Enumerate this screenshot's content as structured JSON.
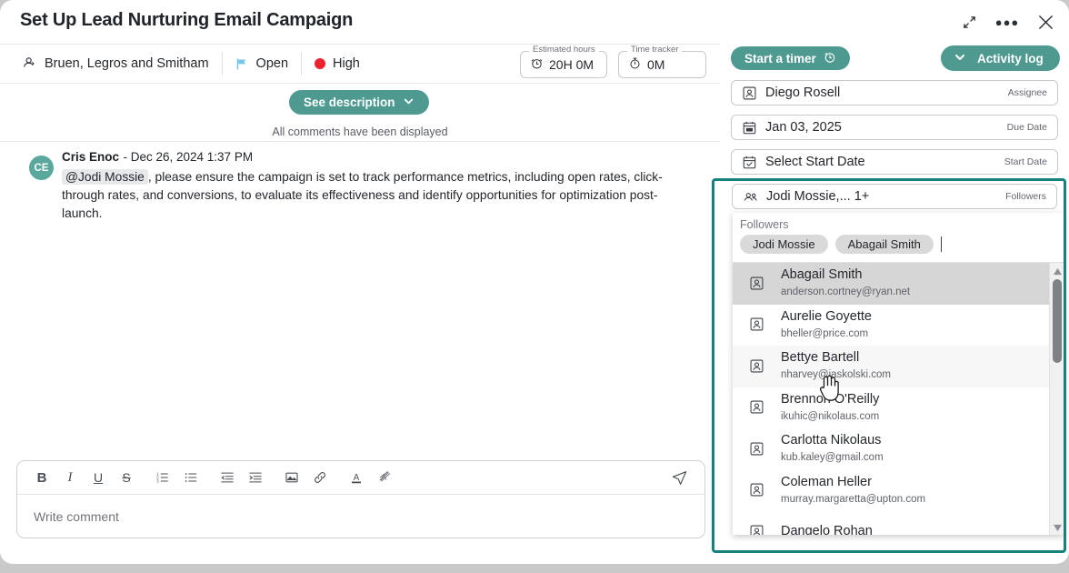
{
  "window": {
    "title": "Set Up Lead Nurturing Email Campaign",
    "expand_icon": "expand-icon",
    "more_icon": "ellipsis-icon",
    "close_icon": "close-icon"
  },
  "meta": {
    "company": "Bruen, Legros and Smitham",
    "company_icon": "company-icon",
    "status": "Open",
    "status_icon": "flag-icon",
    "priority": "High",
    "priority_icon": "priority-dot-icon",
    "estimated_hours": {
      "legend": "Estimated hours",
      "value": "20H 0M",
      "icon": "alarm-clock-icon"
    },
    "time_tracker": {
      "legend": "Time tracker",
      "value": "0M",
      "icon": "stopwatch-icon"
    }
  },
  "description": {
    "see_description_label": "See description",
    "chevron_icon": "chevron-down-icon"
  },
  "comments": {
    "status_line": "All comments have been displayed",
    "items": [
      {
        "initials": "CE",
        "author": "Cris Enoc",
        "date": "- Dec 26, 2024 1:37 PM",
        "mention": "@Jodi Mossie",
        "text": ", please ensure the campaign is set to track performance metrics, including open rates, click-through rates, and conversions, to evaluate its effectiveness and identify opportunities for optimization post-launch."
      }
    ]
  },
  "editor": {
    "placeholder": "Write comment",
    "tools": [
      {
        "name": "bold-icon",
        "glyph": "B"
      },
      {
        "name": "italic-icon",
        "glyph": "I"
      },
      {
        "name": "underline-icon",
        "glyph": "U"
      },
      {
        "name": "strikethrough-icon",
        "glyph": "S"
      },
      {
        "name": "ordered-list-icon",
        "glyph": ""
      },
      {
        "name": "bullet-list-icon",
        "glyph": ""
      },
      {
        "name": "outdent-icon",
        "glyph": ""
      },
      {
        "name": "indent-icon",
        "glyph": ""
      },
      {
        "name": "image-icon",
        "glyph": ""
      },
      {
        "name": "link-icon",
        "glyph": ""
      },
      {
        "name": "text-color-icon",
        "glyph": "A"
      },
      {
        "name": "clear-format-icon",
        "glyph": ""
      }
    ],
    "send_icon": "send-icon"
  },
  "sidebar": {
    "start_timer_label": "Start a timer",
    "start_timer_icon": "timer-icon",
    "activity_log_label": "Activity log",
    "activity_log_icon": "chevron-down-icon",
    "fields": [
      {
        "name": "assignee",
        "icon": "user-icon",
        "value": "Diego Rosell",
        "label": "Assignee"
      },
      {
        "name": "due-date",
        "icon": "calendar-icon",
        "value": "Jan 03, 2025",
        "label": "Due Date"
      },
      {
        "name": "start-date",
        "icon": "calendar-check-icon",
        "value": "Select Start Date",
        "label": "Start Date"
      },
      {
        "name": "followers",
        "icon": "users-icon",
        "value": "Jodi Mossie,... 1+",
        "label": "Followers"
      }
    ]
  },
  "followers_dropdown": {
    "label": "Followers",
    "chips": [
      "Jodi Mossie",
      "Abagail Smith"
    ],
    "scroll_up_icon": "caret-up-icon",
    "scroll_down_icon": "caret-down-icon",
    "options": [
      {
        "name": "Abagail Smith",
        "email": "anderson.cortney@ryan.net"
      },
      {
        "name": "Aurelie Goyette",
        "email": "bheller@price.com"
      },
      {
        "name": "Bettye Bartell",
        "email": "nharvey@jaskolski.com"
      },
      {
        "name": "Brennon O'Reilly",
        "email": "ikuhic@nikolaus.com"
      },
      {
        "name": "Carlotta Nikolaus",
        "email": "kub.kaley@gmail.com"
      },
      {
        "name": "Coleman Heller",
        "email": "murray.margaretta@upton.com"
      },
      {
        "name": "Dangelo Rohan",
        "email": ""
      }
    ]
  },
  "colors": {
    "accent_teal": "#4e9a91",
    "highlight_teal": "#16827d",
    "priority_red": "#ef2030",
    "flag_blue": "#79c5e8",
    "chip_gray": "#d9d9d9"
  }
}
